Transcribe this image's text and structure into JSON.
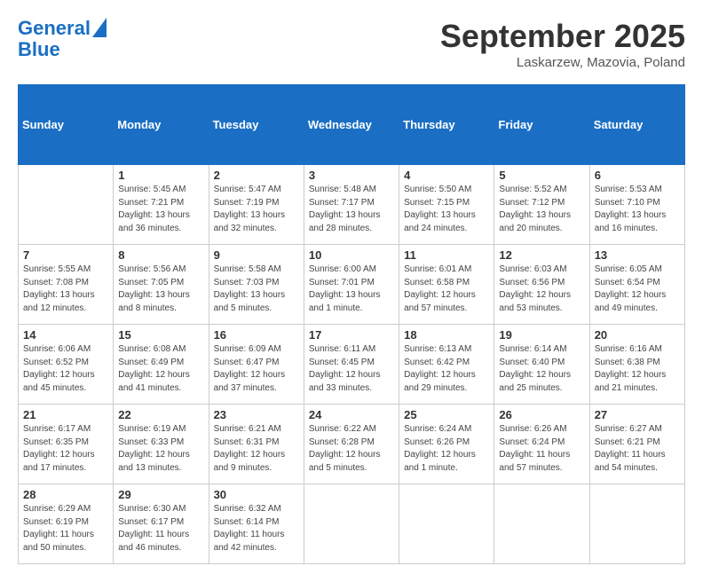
{
  "header": {
    "logo_line1": "General",
    "logo_line2": "Blue",
    "month": "September 2025",
    "location": "Laskarzew, Mazovia, Poland"
  },
  "weekdays": [
    "Sunday",
    "Monday",
    "Tuesday",
    "Wednesday",
    "Thursday",
    "Friday",
    "Saturday"
  ],
  "weeks": [
    [
      {
        "num": "",
        "detail": ""
      },
      {
        "num": "1",
        "detail": "Sunrise: 5:45 AM\nSunset: 7:21 PM\nDaylight: 13 hours\nand 36 minutes."
      },
      {
        "num": "2",
        "detail": "Sunrise: 5:47 AM\nSunset: 7:19 PM\nDaylight: 13 hours\nand 32 minutes."
      },
      {
        "num": "3",
        "detail": "Sunrise: 5:48 AM\nSunset: 7:17 PM\nDaylight: 13 hours\nand 28 minutes."
      },
      {
        "num": "4",
        "detail": "Sunrise: 5:50 AM\nSunset: 7:15 PM\nDaylight: 13 hours\nand 24 minutes."
      },
      {
        "num": "5",
        "detail": "Sunrise: 5:52 AM\nSunset: 7:12 PM\nDaylight: 13 hours\nand 20 minutes."
      },
      {
        "num": "6",
        "detail": "Sunrise: 5:53 AM\nSunset: 7:10 PM\nDaylight: 13 hours\nand 16 minutes."
      }
    ],
    [
      {
        "num": "7",
        "detail": "Sunrise: 5:55 AM\nSunset: 7:08 PM\nDaylight: 13 hours\nand 12 minutes."
      },
      {
        "num": "8",
        "detail": "Sunrise: 5:56 AM\nSunset: 7:05 PM\nDaylight: 13 hours\nand 8 minutes."
      },
      {
        "num": "9",
        "detail": "Sunrise: 5:58 AM\nSunset: 7:03 PM\nDaylight: 13 hours\nand 5 minutes."
      },
      {
        "num": "10",
        "detail": "Sunrise: 6:00 AM\nSunset: 7:01 PM\nDaylight: 13 hours\nand 1 minute."
      },
      {
        "num": "11",
        "detail": "Sunrise: 6:01 AM\nSunset: 6:58 PM\nDaylight: 12 hours\nand 57 minutes."
      },
      {
        "num": "12",
        "detail": "Sunrise: 6:03 AM\nSunset: 6:56 PM\nDaylight: 12 hours\nand 53 minutes."
      },
      {
        "num": "13",
        "detail": "Sunrise: 6:05 AM\nSunset: 6:54 PM\nDaylight: 12 hours\nand 49 minutes."
      }
    ],
    [
      {
        "num": "14",
        "detail": "Sunrise: 6:06 AM\nSunset: 6:52 PM\nDaylight: 12 hours\nand 45 minutes."
      },
      {
        "num": "15",
        "detail": "Sunrise: 6:08 AM\nSunset: 6:49 PM\nDaylight: 12 hours\nand 41 minutes."
      },
      {
        "num": "16",
        "detail": "Sunrise: 6:09 AM\nSunset: 6:47 PM\nDaylight: 12 hours\nand 37 minutes."
      },
      {
        "num": "17",
        "detail": "Sunrise: 6:11 AM\nSunset: 6:45 PM\nDaylight: 12 hours\nand 33 minutes."
      },
      {
        "num": "18",
        "detail": "Sunrise: 6:13 AM\nSunset: 6:42 PM\nDaylight: 12 hours\nand 29 minutes."
      },
      {
        "num": "19",
        "detail": "Sunrise: 6:14 AM\nSunset: 6:40 PM\nDaylight: 12 hours\nand 25 minutes."
      },
      {
        "num": "20",
        "detail": "Sunrise: 6:16 AM\nSunset: 6:38 PM\nDaylight: 12 hours\nand 21 minutes."
      }
    ],
    [
      {
        "num": "21",
        "detail": "Sunrise: 6:17 AM\nSunset: 6:35 PM\nDaylight: 12 hours\nand 17 minutes."
      },
      {
        "num": "22",
        "detail": "Sunrise: 6:19 AM\nSunset: 6:33 PM\nDaylight: 12 hours\nand 13 minutes."
      },
      {
        "num": "23",
        "detail": "Sunrise: 6:21 AM\nSunset: 6:31 PM\nDaylight: 12 hours\nand 9 minutes."
      },
      {
        "num": "24",
        "detail": "Sunrise: 6:22 AM\nSunset: 6:28 PM\nDaylight: 12 hours\nand 5 minutes."
      },
      {
        "num": "25",
        "detail": "Sunrise: 6:24 AM\nSunset: 6:26 PM\nDaylight: 12 hours\nand 1 minute."
      },
      {
        "num": "26",
        "detail": "Sunrise: 6:26 AM\nSunset: 6:24 PM\nDaylight: 11 hours\nand 57 minutes."
      },
      {
        "num": "27",
        "detail": "Sunrise: 6:27 AM\nSunset: 6:21 PM\nDaylight: 11 hours\nand 54 minutes."
      }
    ],
    [
      {
        "num": "28",
        "detail": "Sunrise: 6:29 AM\nSunset: 6:19 PM\nDaylight: 11 hours\nand 50 minutes."
      },
      {
        "num": "29",
        "detail": "Sunrise: 6:30 AM\nSunset: 6:17 PM\nDaylight: 11 hours\nand 46 minutes."
      },
      {
        "num": "30",
        "detail": "Sunrise: 6:32 AM\nSunset: 6:14 PM\nDaylight: 11 hours\nand 42 minutes."
      },
      {
        "num": "",
        "detail": ""
      },
      {
        "num": "",
        "detail": ""
      },
      {
        "num": "",
        "detail": ""
      },
      {
        "num": "",
        "detail": ""
      }
    ]
  ]
}
